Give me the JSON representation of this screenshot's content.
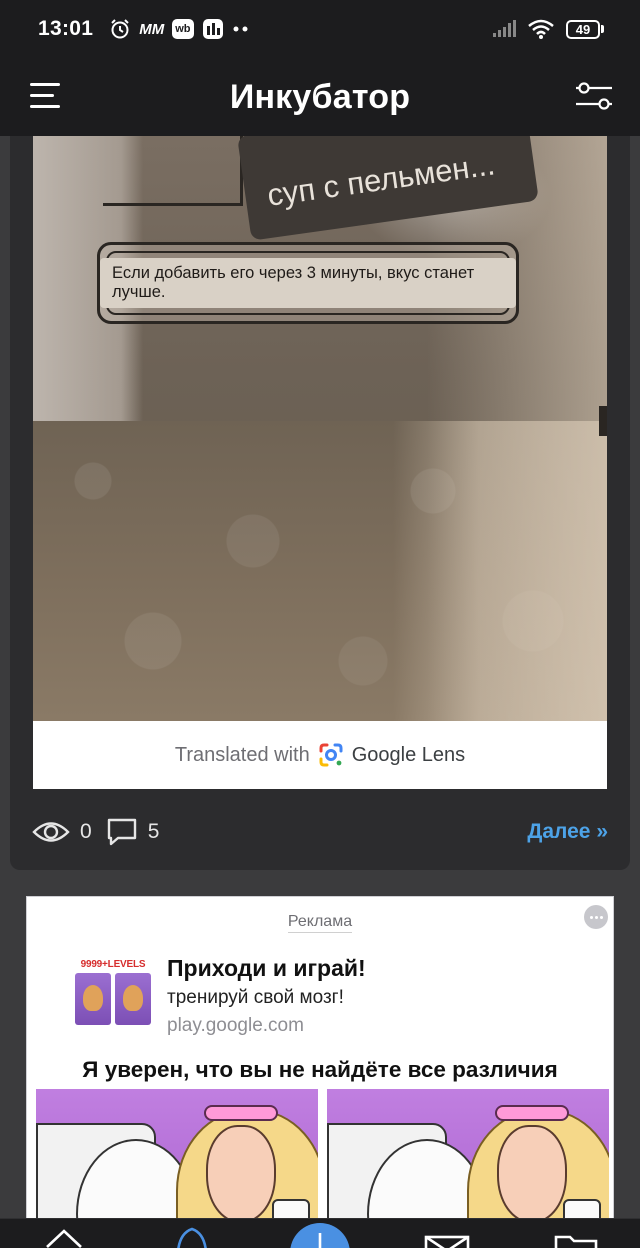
{
  "status_bar": {
    "time": "13:01",
    "app_badges": [
      "MM",
      "wb"
    ],
    "battery_level": "49"
  },
  "app_bar": {
    "title": "Инкубатор"
  },
  "post": {
    "photo_texts": {
      "package_label": "суп с пельмен...",
      "note": "Если добавить его через 3 минуты, вкус станет лучше."
    },
    "lens_caption": {
      "prefix": "Translated with",
      "brand": "Google Lens"
    },
    "views": "0",
    "comments": "5",
    "more_link": "Далее »"
  },
  "ad": {
    "label": "Реклама",
    "icon_text": "9999+LEVELS",
    "title": "Приходи и играй!",
    "subtitle": "тренируй свой мозг!",
    "domain": "play.google.com",
    "headline": "Я уверен, что вы не найдёте все различия"
  },
  "colors": {
    "background": "#3b3b3d",
    "bar": "#1c1c1e",
    "card": "#2c2c2e",
    "link": "#4da3e8",
    "fab": "#4a90e2"
  },
  "icons": {
    "menu": "hamburger-icon",
    "filter": "sliders-icon",
    "views": "eye-icon",
    "comments": "comment-icon",
    "nav": [
      "home-icon",
      "drop-icon",
      "plus-icon",
      "mail-icon",
      "folder-icon"
    ]
  }
}
